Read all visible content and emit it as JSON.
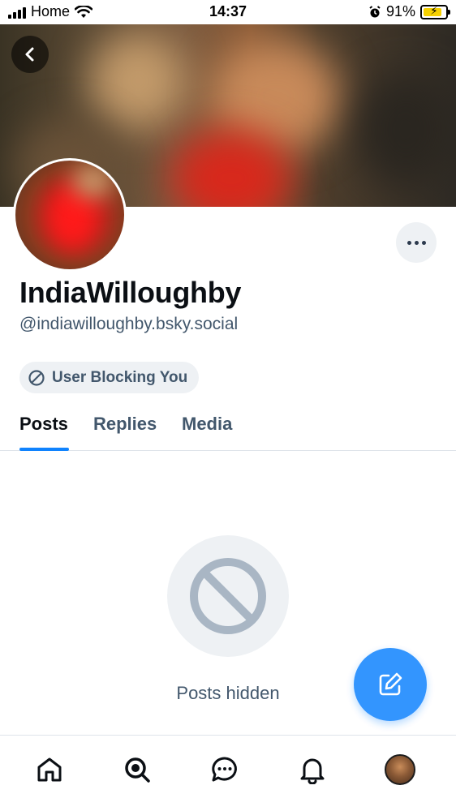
{
  "status_bar": {
    "carrier": "Home",
    "time": "14:37",
    "battery": "91%",
    "battery_level": 0.91,
    "icons": [
      "signal-icon",
      "wifi-icon",
      "alarm-icon",
      "battery-icon"
    ]
  },
  "profile": {
    "display_name": "IndiaWilloughby",
    "handle": "@indiawilloughby.bsky.social",
    "blocked_badge": "User Blocking You"
  },
  "tabs": [
    {
      "label": "Posts",
      "active": true
    },
    {
      "label": "Replies",
      "active": false
    },
    {
      "label": "Media",
      "active": false
    }
  ],
  "empty_state": {
    "message": "Posts hidden",
    "icon": "blocked-icon"
  },
  "bottom_nav": {
    "items": [
      "home-icon",
      "search-icon",
      "chat-icon",
      "notifications-icon",
      "profile-avatar"
    ]
  },
  "colors": {
    "accent": "#1083fe",
    "muted_text": "#42576c",
    "badge_bg": "#eef1f4"
  }
}
